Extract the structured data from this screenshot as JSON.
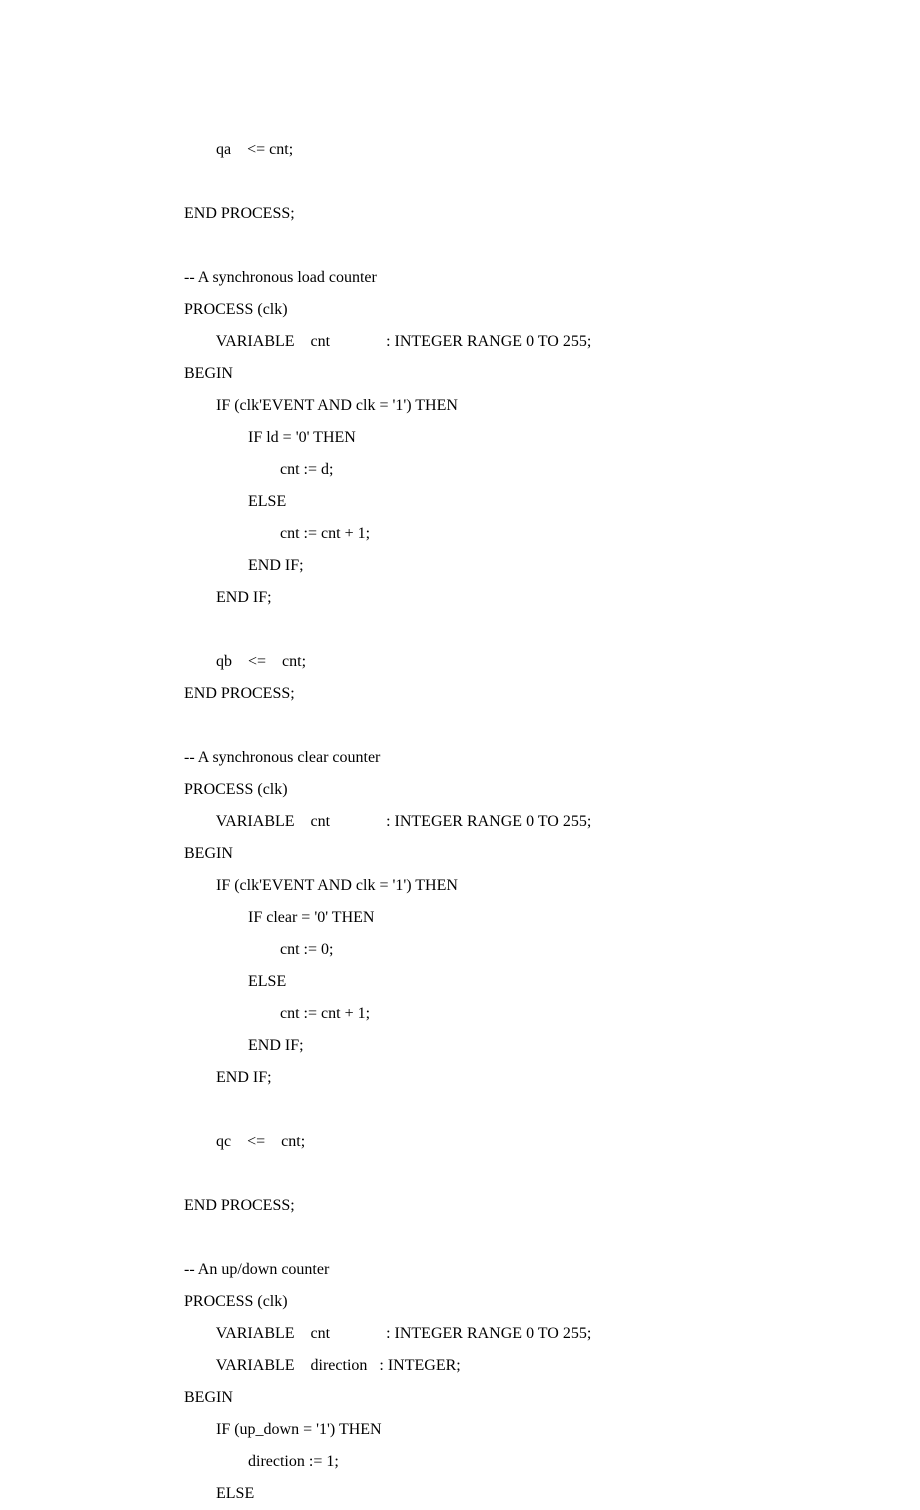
{
  "code": {
    "lines": [
      "        qa    <= cnt;",
      "",
      "END PROCESS;",
      "",
      "-- A synchronous load counter",
      "PROCESS (clk)",
      "        VARIABLE    cnt              : INTEGER RANGE 0 TO 255;",
      "BEGIN",
      "        IF (clk'EVENT AND clk = '1') THEN",
      "                IF ld = '0' THEN",
      "                        cnt := d;",
      "                ELSE",
      "                        cnt := cnt + 1;",
      "                END IF;",
      "        END IF;",
      "",
      "        qb    <=    cnt;",
      "END PROCESS;",
      "",
      "-- A synchronous clear counter",
      "PROCESS (clk)",
      "        VARIABLE    cnt              : INTEGER RANGE 0 TO 255;",
      "BEGIN",
      "        IF (clk'EVENT AND clk = '1') THEN",
      "                IF clear = '0' THEN",
      "                        cnt := 0;",
      "                ELSE",
      "                        cnt := cnt + 1;",
      "                END IF;",
      "        END IF;",
      "",
      "        qc    <=    cnt;",
      "",
      "END PROCESS;",
      "",
      "-- An up/down counter",
      "PROCESS (clk)",
      "        VARIABLE    cnt              : INTEGER RANGE 0 TO 255;",
      "        VARIABLE    direction   : INTEGER;",
      "BEGIN",
      "        IF (up_down = '1') THEN",
      "                direction := 1;",
      "        ELSE"
    ]
  }
}
